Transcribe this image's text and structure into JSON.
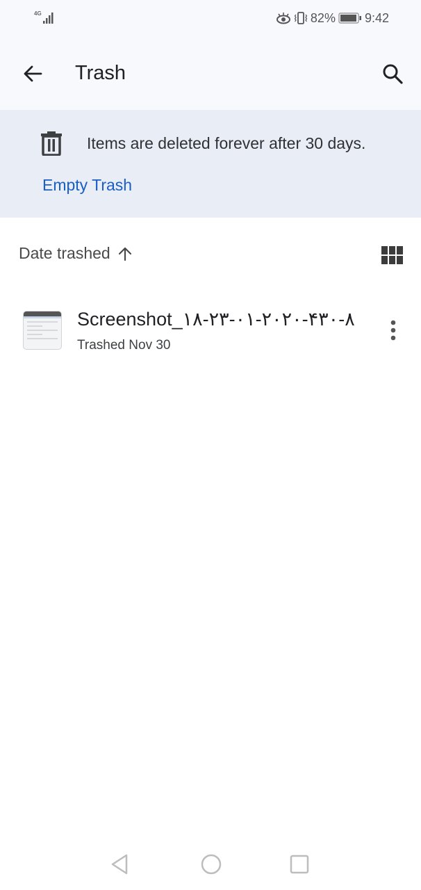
{
  "status_bar": {
    "network": "4G",
    "battery_percent": "82%",
    "time": "9:42",
    "icons": [
      "signal-icon",
      "eye-comfort-icon",
      "vibrate-icon",
      "battery-icon"
    ]
  },
  "app_bar": {
    "back_icon": "arrow-left-icon",
    "title": "Trash",
    "search_icon": "search-icon"
  },
  "banner": {
    "icon": "trash-can-icon",
    "message": "Items are deleted forever after 30 days.",
    "action_label": "Empty Trash",
    "action_color": "#1a5fc4"
  },
  "sort": {
    "label": "Date trashed",
    "direction_icon": "arrow-up-icon",
    "view_toggle_icon": "grid-view-icon"
  },
  "files": [
    {
      "name": "Screenshot_٢٠٢٠-٠١-٢٣-١٨-۴٨-٣٠",
      "subtitle": "Trashed Nov 30",
      "thumbnail": "screenshot-thumbnail",
      "menu_icon": "more-vert-icon"
    }
  ],
  "nav_bar": {
    "buttons": [
      "back-triangle-icon",
      "home-circle-icon",
      "recents-square-icon"
    ]
  }
}
